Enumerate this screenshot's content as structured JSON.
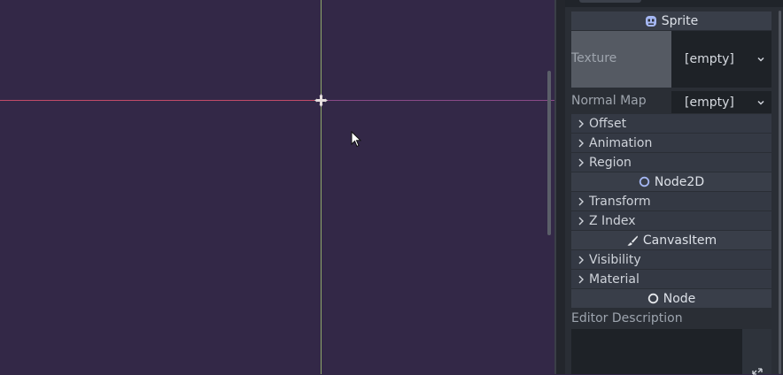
{
  "inspector": {
    "sections": {
      "sprite": "Sprite",
      "node2d": "Node2D",
      "canvas_item": "CanvasItem",
      "node": "Node"
    },
    "properties": {
      "texture": {
        "label": "Texture",
        "value": "[empty]"
      },
      "normal_map": {
        "label": "Normal Map",
        "value": "[empty]"
      },
      "editor_description": {
        "label": "Editor Description"
      }
    },
    "groups": {
      "offset": "Offset",
      "animation": "Animation",
      "region": "Region",
      "transform": "Transform",
      "z_index": "Z Index",
      "visibility": "Visibility",
      "material": "Material"
    },
    "icons": {
      "sprite": "sprite-icon",
      "node2d": "node2d-icon",
      "canvas_item": "brush-icon",
      "node": "node-icon",
      "expand": "expand-icon",
      "dropdown": "chevron-down-icon",
      "collapsed": "chevron-right-icon"
    }
  },
  "colors": {
    "viewport_bg": "#332847",
    "axis_y": "#8fa86a",
    "axis_x": "#c24b69",
    "section_header": "#393e49",
    "panel_bg": "#2a2e35",
    "accent_icon": "#a5b7f3"
  }
}
